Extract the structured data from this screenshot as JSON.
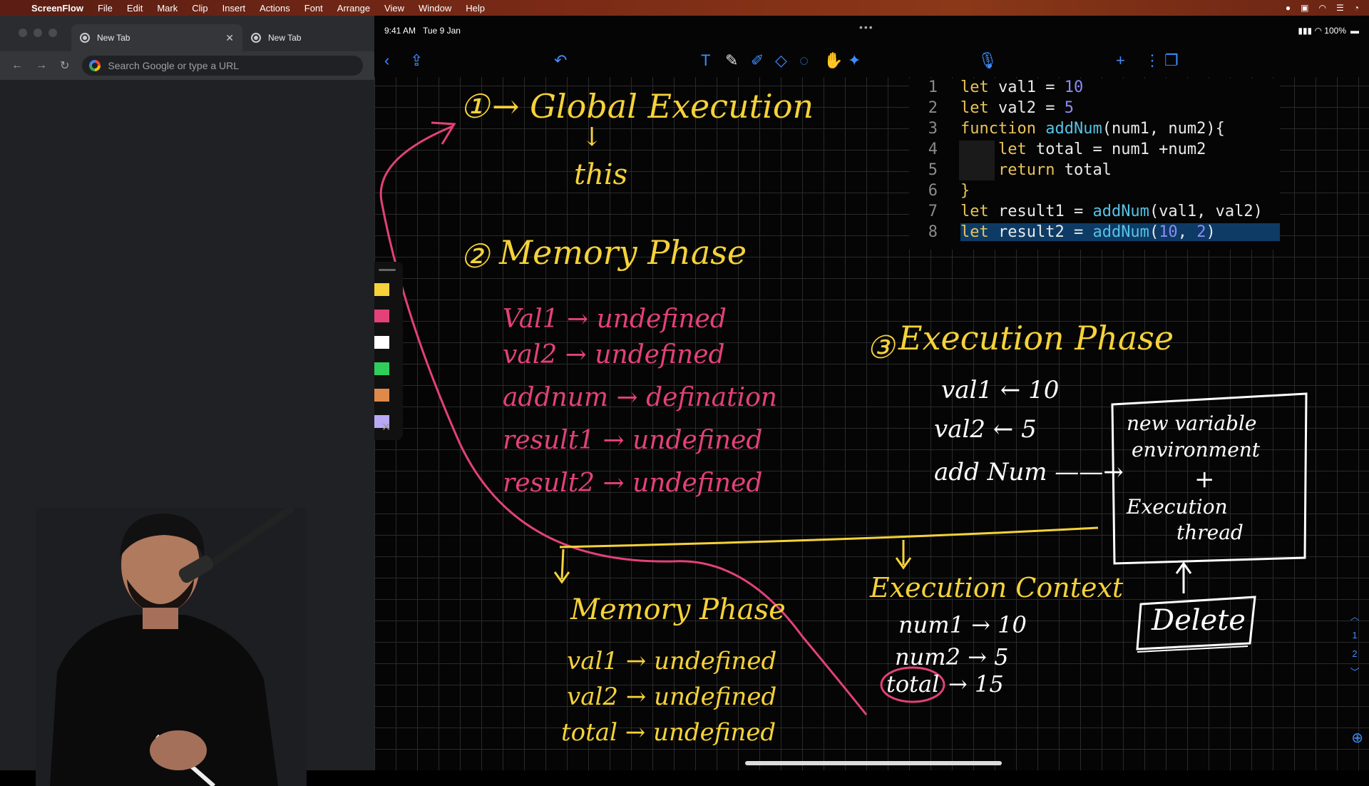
{
  "menubar": {
    "app": "ScreenFlow",
    "items": [
      "File",
      "Edit",
      "Mark",
      "Clip",
      "Insert",
      "Actions",
      "Font",
      "Arrange",
      "View",
      "Window",
      "Help"
    ]
  },
  "browser": {
    "tabs": [
      {
        "title": "New Tab"
      },
      {
        "title": "New Tab"
      }
    ],
    "omnibox_placeholder": "Search Google or type a URL"
  },
  "ipad": {
    "time": "9:41 AM",
    "date": "Tue 9 Jan",
    "battery": "100%",
    "page_indicator": [
      "1",
      "2"
    ]
  },
  "code": {
    "lines": [
      {
        "n": "1",
        "tokens": [
          [
            "kw",
            "let "
          ],
          [
            "id",
            "val1 "
          ],
          [
            "op",
            "= "
          ],
          [
            "num",
            "10"
          ]
        ]
      },
      {
        "n": "2",
        "tokens": [
          [
            "kw",
            "let "
          ],
          [
            "id",
            "val2 "
          ],
          [
            "op",
            "= "
          ],
          [
            "num",
            "5"
          ]
        ]
      },
      {
        "n": "3",
        "tokens": [
          [
            "kw",
            "function "
          ],
          [
            "fn",
            "addNum"
          ],
          [
            "id",
            "(num1, num2){"
          ]
        ]
      },
      {
        "n": "4",
        "tokens": [
          [
            "id",
            "    "
          ],
          [
            "kw",
            "let "
          ],
          [
            "id",
            "total "
          ],
          [
            "op",
            "= "
          ],
          [
            "id",
            "num1 +num2"
          ]
        ]
      },
      {
        "n": "5",
        "tokens": [
          [
            "id",
            "    "
          ],
          [
            "kw",
            "return "
          ],
          [
            "id",
            "total"
          ]
        ]
      },
      {
        "n": "6",
        "tokens": [
          [
            "kw",
            "}"
          ]
        ]
      },
      {
        "n": "7",
        "tokens": [
          [
            "kw",
            "let "
          ],
          [
            "id",
            "result1 "
          ],
          [
            "op",
            "= "
          ],
          [
            "fn",
            "addNum"
          ],
          [
            "id",
            "(val1, val2)"
          ]
        ]
      },
      {
        "n": "8",
        "tokens": [
          [
            "kw",
            "let "
          ],
          [
            "id",
            "result2 "
          ],
          [
            "op",
            "= "
          ],
          [
            "fn",
            "addNum"
          ],
          [
            "id",
            "("
          ],
          [
            "num",
            "10"
          ],
          [
            "id",
            ", "
          ],
          [
            "num",
            "2"
          ],
          [
            "id",
            ")"
          ]
        ]
      }
    ],
    "highlighted_line": 8
  },
  "notes": {
    "global": {
      "num": "①",
      "title": "→ Global Execution",
      "arrow": "↓",
      "this": "this"
    },
    "memory": {
      "num": "②",
      "title": "Memory Phase",
      "rows": [
        "Val1 → undefined",
        "val2 → undefined",
        "addnum → defination",
        "result1 → undefined",
        "result2 → undefined"
      ]
    },
    "execution": {
      "num": "③",
      "title": "Execution Phase",
      "rows": [
        "val1 ← 10",
        "val2 ← 5",
        "add Num ——→"
      ]
    },
    "box": {
      "l1": "new variable",
      "l2": "environment",
      "plus": "+",
      "l3": "Execution",
      "l4": "thread"
    },
    "delete": "Delete",
    "context": {
      "title": "Execution Context",
      "rows": [
        "num1 → 10",
        "num2 → 5"
      ],
      "total": "total",
      "total_value": "→ 15"
    },
    "memory2": {
      "title": "Memory Phase",
      "rows": [
        "val1 → undefined",
        "val2 → undefined",
        "total → undefined"
      ]
    }
  },
  "palette": {
    "colors": [
      "#f5d23a",
      "#e3417a",
      "#ffffff",
      "#2fce5a",
      "#e08a4a",
      "#b9a8f5"
    ]
  }
}
